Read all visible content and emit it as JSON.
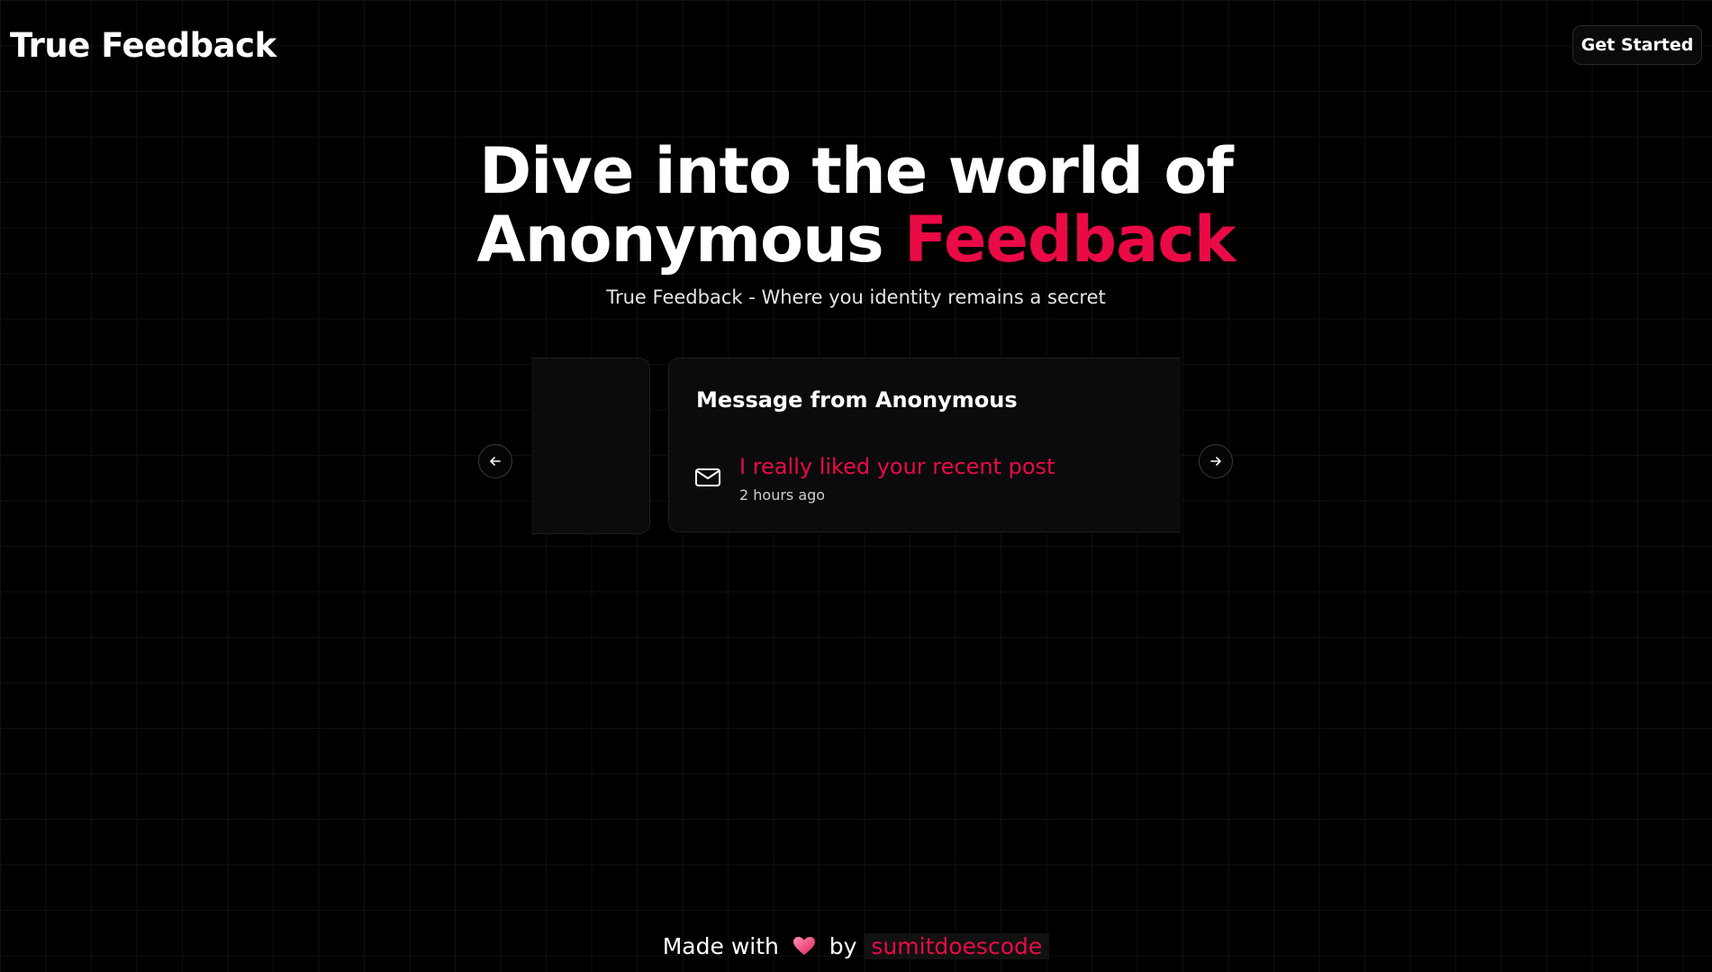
{
  "header": {
    "brand": "True Feedback",
    "cta_label": "Get Started"
  },
  "hero": {
    "title_line1": "Dive into the world of",
    "title_line2_plain": "Anonymous",
    "title_line2_accent": "Feedback",
    "subtitle": "True Feedback - Where you identity remains a secret"
  },
  "carousel": {
    "card": {
      "title": "Message from Anonymous",
      "icon": "mail-icon",
      "message": "I really liked your recent post",
      "time": "2 hours ago"
    },
    "prev_icon": "arrow-left-icon",
    "next_icon": "arrow-right-icon"
  },
  "footer": {
    "prefix": "Made with",
    "heart_icon": "heart-icon",
    "by": "by",
    "author": "sumitdoescode"
  },
  "colors": {
    "background": "#000000",
    "accent": "#ea0a46",
    "text": "#ffffff",
    "card": "#0b0b0d"
  }
}
